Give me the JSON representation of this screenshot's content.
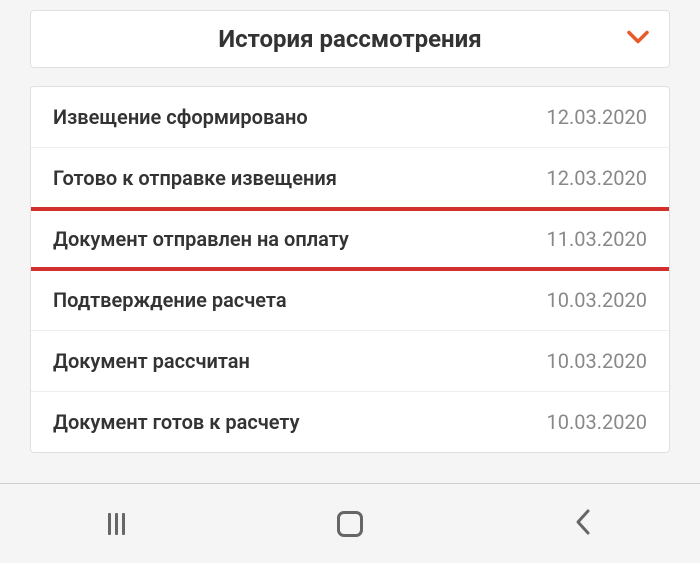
{
  "header": {
    "title": "История рассмотрения"
  },
  "history": [
    {
      "label": "Извещение сформировано",
      "date": "12.03.2020",
      "highlighted": false
    },
    {
      "label": "Готово к отправке извещения",
      "date": "12.03.2020",
      "highlighted": false
    },
    {
      "label": "Документ отправлен на оплату",
      "date": "11.03.2020",
      "highlighted": true
    },
    {
      "label": "Подтверждение расчета",
      "date": "10.03.2020",
      "highlighted": false
    },
    {
      "label": "Документ рассчитан",
      "date": "10.03.2020",
      "highlighted": false
    },
    {
      "label": "Документ готов к расчету",
      "date": "10.03.2020",
      "highlighted": false
    }
  ]
}
